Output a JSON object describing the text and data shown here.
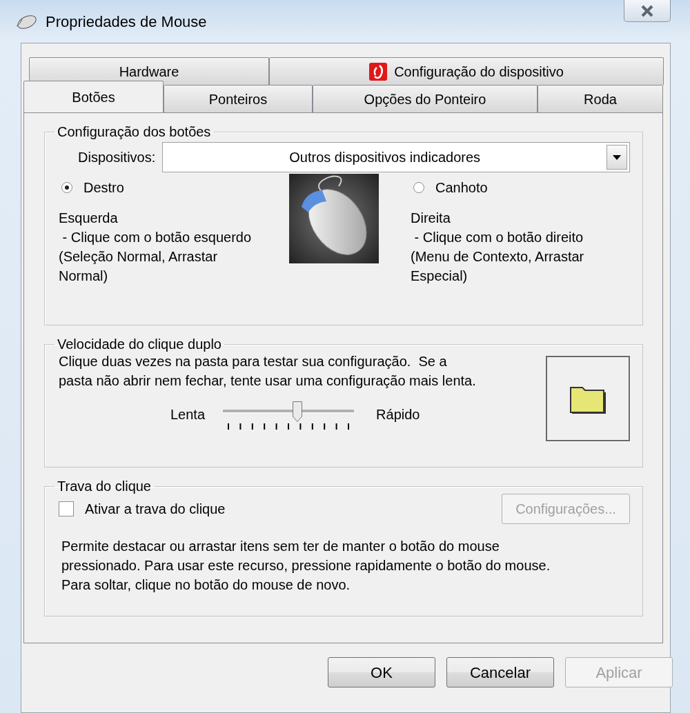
{
  "window": {
    "title": "Propriedades de Mouse"
  },
  "tab_rows": [
    [
      {
        "label": "Hardware",
        "selected": false
      },
      {
        "label": "Configuração do dispositivo",
        "selected": false,
        "kind": "icon"
      }
    ],
    [
      {
        "label": "Botões",
        "selected": true
      },
      {
        "label": "Ponteiros",
        "selected": false
      },
      {
        "label": "Opções do Ponteiro",
        "selected": false
      },
      {
        "label": "Roda",
        "selected": false
      }
    ]
  ],
  "button_config": {
    "legend": "Configuração dos botões",
    "devices_label": "Dispositivos:",
    "devices_value": "Outros dispositivos indicadores",
    "options": [
      {
        "label": "Destro",
        "selected": true,
        "description": [
          "Esquerda",
          " - Clique com o botão esquerdo",
          "(Seleção Normal, Arrastar",
          "Normal)"
        ]
      },
      {
        "label": "Canhoto",
        "selected": false,
        "description": [
          "Direita",
          " - Clique com o botão direito",
          "(Menu de Contexto, Arrastar",
          "Especial)"
        ]
      }
    ]
  },
  "double_click": {
    "legend": "Velocidade do clique duplo",
    "instructions": [
      "Clique duas vezes na pasta para testar sua configuração.  Se a",
      "pasta não abrir nem fechar, tente usar uma configuração mais lenta."
    ],
    "slow_label": "Lenta",
    "fast_label": "Rápido",
    "speed": {
      "level": 0.57
    }
  },
  "click_lock": {
    "legend": "Trava do clique",
    "checkbox": {
      "label": "Ativar a trava do clique",
      "checked": false
    },
    "settings_button": {
      "label": "Configurações...",
      "disabled": true
    },
    "description": [
      "Permite destacar ou arrastar itens sem ter de manter o botão do mouse",
      "pressionado. Para usar este recurso, pressione rapidamente o botão do mouse.",
      "Para soltar, clique no botão do mouse de novo."
    ]
  },
  "buttons": [
    {
      "label": "OK",
      "disabled": false
    },
    {
      "label": "Cancelar",
      "disabled": false
    },
    {
      "label": "Aplicar",
      "disabled": true
    }
  ]
}
